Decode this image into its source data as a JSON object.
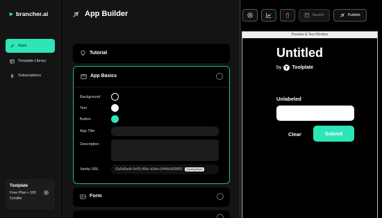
{
  "brand": {
    "name": "brancher.ai"
  },
  "sidebar": {
    "items": [
      {
        "label": "Apps",
        "icon": "rocket-icon",
        "active": true
      },
      {
        "label": "Template Library",
        "icon": "library-icon",
        "active": false
      },
      {
        "label": "Subscriptions",
        "icon": "bolt-icon",
        "active": false
      }
    ],
    "account": {
      "name": "Toolplate",
      "plan": "Free Plan • 100 Credits",
      "icon": "gear-icon"
    }
  },
  "header": {
    "title": "App Builder",
    "buttons": {
      "add_icon": "plus-circle-icon",
      "analytics_icon": "chart-icon",
      "delete_icon": "trash-icon",
      "saved_label": "Saved!",
      "publish_label": "Publish"
    }
  },
  "panels": {
    "tutorial": {
      "title": "Tutorial",
      "icon": "lightbulb-icon"
    },
    "basics": {
      "title": "App Basics",
      "icon": "window-icon",
      "background_label": "Background",
      "text_label": "Text",
      "button_label": "Button",
      "app_title_label": "App Title",
      "app_title_value": "",
      "description_label": "Description",
      "description_value": "",
      "vanity_label": "Vanity URL",
      "vanity_value": "/0a5d6ad4-0e55-46dc-b3de-c044b0d39860",
      "vanity_badge": "Coming Soon",
      "colors": {
        "background": "#000000",
        "text": "#ffffff",
        "button": "#2ee5b8"
      }
    },
    "form": {
      "title": "Form",
      "icon": "form-icon"
    }
  },
  "preview": {
    "header": "Preview & Test Window",
    "title": "Untitled",
    "by": "by",
    "author": "Toolplate",
    "field_label": "Unlabeled",
    "field_value": "",
    "clear_label": "Clear",
    "submit_label": "Submit"
  },
  "colors": {
    "accent": "#2ee5b8",
    "panel_border": "#1fb58f",
    "delete": "#e5484d"
  }
}
